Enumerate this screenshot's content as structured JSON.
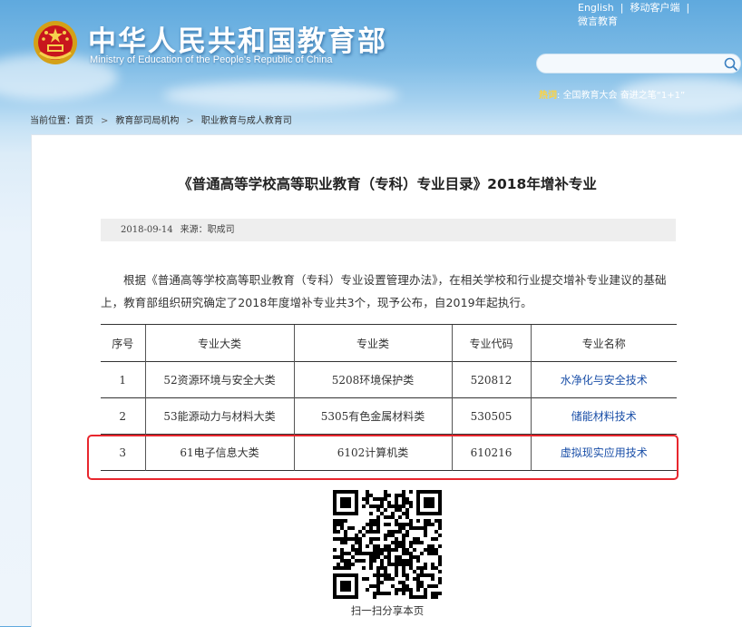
{
  "header": {
    "title": "中华人民共和国教育部",
    "subtitle": "Ministry of Education of the People's Republic of China",
    "links": [
      "English",
      "移动客户端",
      "微言教育"
    ],
    "search": {
      "placeholder": "",
      "icon": "search-icon"
    },
    "hot": {
      "label": "热词",
      "text": "全国教育大会  奋进之笔“1+1”"
    }
  },
  "breadcrumb": {
    "prefix": "当前位置：",
    "items": [
      "首页",
      "教育部司局机构",
      "职业教育与成人教育司"
    ]
  },
  "article": {
    "title": "《普通高等学校高等职业教育（专科）专业目录》2018年增补专业",
    "date": "2018-09-14",
    "source": "来源：职成司",
    "paragraph": "根据《普通高等学校高等职业教育（专科）专业设置管理办法》，在相关学校和行业提交增补专业建议的基础上，教育部组织研究确定了2018年度增补专业共3个，现予公布，自2019年起执行。"
  },
  "table": {
    "headers": [
      "序号",
      "专业大类",
      "专业类",
      "专业代码",
      "专业名称"
    ],
    "rows": [
      [
        "1",
        "52资源环境与安全大类",
        "5208环境保护类",
        "520812",
        "水净化与安全技术"
      ],
      [
        "2",
        "53能源动力与材料大类",
        "5305有色金属材料类",
        "530505",
        "储能材料技术"
      ],
      [
        "3",
        "61电子信息大类",
        "6102计算机类",
        "610216",
        "虚拟现实应用技术"
      ]
    ]
  },
  "qr": {
    "caption": "扫一扫分享本页"
  },
  "colors": {
    "highlight": "#e8262d",
    "link": "#1a4fa8",
    "hot_label": "#ffd23c"
  }
}
